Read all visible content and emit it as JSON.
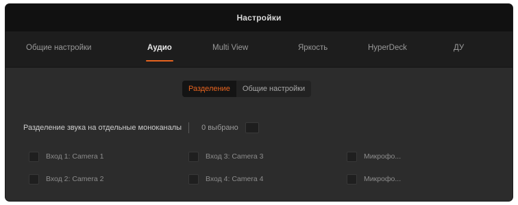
{
  "window": {
    "title": "Настройки"
  },
  "tabs": [
    {
      "label": "Общие настройки",
      "active": false
    },
    {
      "label": "Аудио",
      "active": true
    },
    {
      "label": "Multi View",
      "active": false
    },
    {
      "label": "Яркость",
      "active": false
    },
    {
      "label": "HyperDeck",
      "active": false
    },
    {
      "label": "ДУ",
      "active": false
    }
  ],
  "audio": {
    "segments": [
      {
        "label": "Разделение",
        "active": true
      },
      {
        "label": "Общие настройки",
        "active": false
      }
    ],
    "split": {
      "label": "Разделение звука на отдельные моноканалы",
      "status": "0 выбрано",
      "checked": false
    },
    "channels": [
      {
        "label": "Вход 1: Camera 1",
        "checked": false
      },
      {
        "label": "Вход 2: Camera 2",
        "checked": false
      },
      {
        "label": "Вход 3: Camera 3",
        "checked": false
      },
      {
        "label": "Вход 4: Camera 4",
        "checked": false
      },
      {
        "label": "Микрофо...",
        "checked": false
      },
      {
        "label": "Микрофо...",
        "checked": false
      }
    ]
  },
  "colors": {
    "accent": "#e8641f",
    "window_bg": "#2c2c2c",
    "titlebar_bg": "#111111",
    "tabbar_bg": "#1d1d1d"
  }
}
